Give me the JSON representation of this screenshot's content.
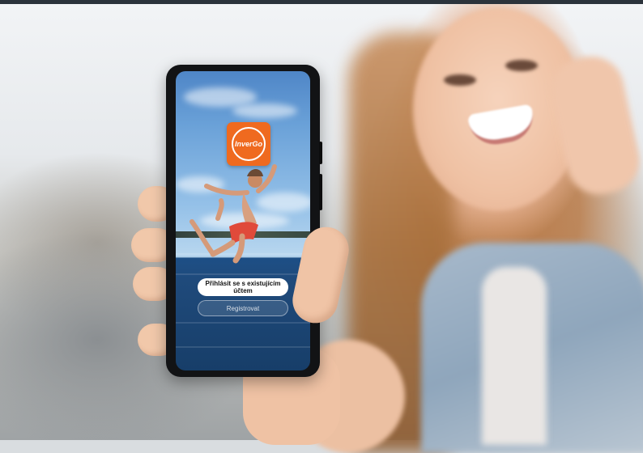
{
  "app": {
    "logo_text": "InverGo",
    "brand_color": "#ef6a1f"
  },
  "buttons": {
    "login_label": "Přihlásit se s existujícím účtem",
    "register_label": "Registrovat"
  }
}
